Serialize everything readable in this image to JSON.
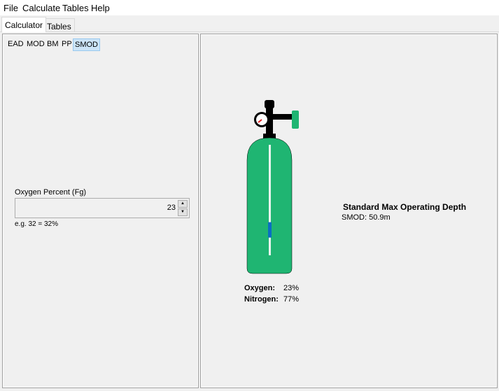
{
  "menu": [
    "File",
    "Calculate",
    "Tables",
    "Help"
  ],
  "tabs": {
    "active": "Calculator",
    "inactive": "Tables"
  },
  "modes": [
    "EAD",
    "MOD",
    "BM",
    "PP",
    "SMOD"
  ],
  "selected_mode": "SMOD",
  "input": {
    "label": "Oxygen Percent (Fg)",
    "value": "23",
    "hint": "e.g. 32 = 32%"
  },
  "tank": {
    "color": "#1fb572",
    "level_fraction": 0.23,
    "oxygen_label": "Oxygen:",
    "oxygen_value": "23%",
    "nitrogen_label": "Nitrogen:",
    "nitrogen_value": "77%"
  },
  "result": {
    "title": "Standard Max Operating Depth",
    "line": "SMOD: 50.9m"
  }
}
